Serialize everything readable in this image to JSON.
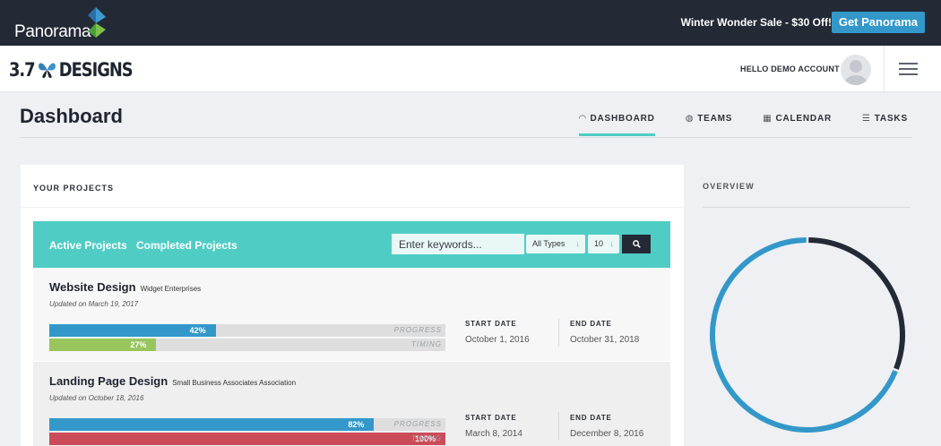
{
  "banner": {
    "logo_text": "Panorama",
    "promo": "Winter Wonder Sale - $30 Off!",
    "cta": "Get Panorama"
  },
  "header": {
    "brand_prefix": "3.7",
    "brand_suffix": "DESIGNS",
    "greeting": "HELLO DEMO ACCOUNT"
  },
  "page": {
    "title": "Dashboard",
    "tabs": [
      {
        "label": "DASHBOARD",
        "icon": "gauge-icon",
        "active": true
      },
      {
        "label": "TEAMS",
        "icon": "globe-icon",
        "active": false
      },
      {
        "label": "CALENDAR",
        "icon": "calendar-icon",
        "active": false
      },
      {
        "label": "TASKS",
        "icon": "list-icon",
        "active": false
      }
    ]
  },
  "projects_card": {
    "title": "YOUR PROJECTS",
    "filter_tabs": [
      "Active Projects",
      "Completed Projects"
    ],
    "search_placeholder": "Enter keywords...",
    "type_select": "All Types",
    "count_select": "10",
    "progress_label": "PROGRESS",
    "timing_label": "TIMING",
    "start_label": "START DATE",
    "end_label": "END DATE",
    "projects": [
      {
        "name": "Website Design",
        "client": "Widget Enterprises",
        "updated": "Updated on March 19, 2017",
        "progress": "42%",
        "timing": "27%",
        "timing_color": "#98c65c",
        "start": "October 1, 2016",
        "end": "October 31, 2018"
      },
      {
        "name": "Landing Page Design",
        "client": "Small Business Associates Association",
        "updated": "Updated on October 18, 2016",
        "progress": "82%",
        "timing": "100%",
        "timing_color": "#cc4b58",
        "start": "March 8, 2014",
        "end": "December 8, 2016"
      }
    ]
  },
  "overview": {
    "title": "OVERVIEW",
    "segments": [
      {
        "value": 0.31,
        "color": "#232935"
      },
      {
        "value": 0.69,
        "color": "#3398c9"
      }
    ]
  },
  "colors": {
    "teal": "#4fcdc5",
    "blue": "#3398c9",
    "dark": "#232935"
  }
}
